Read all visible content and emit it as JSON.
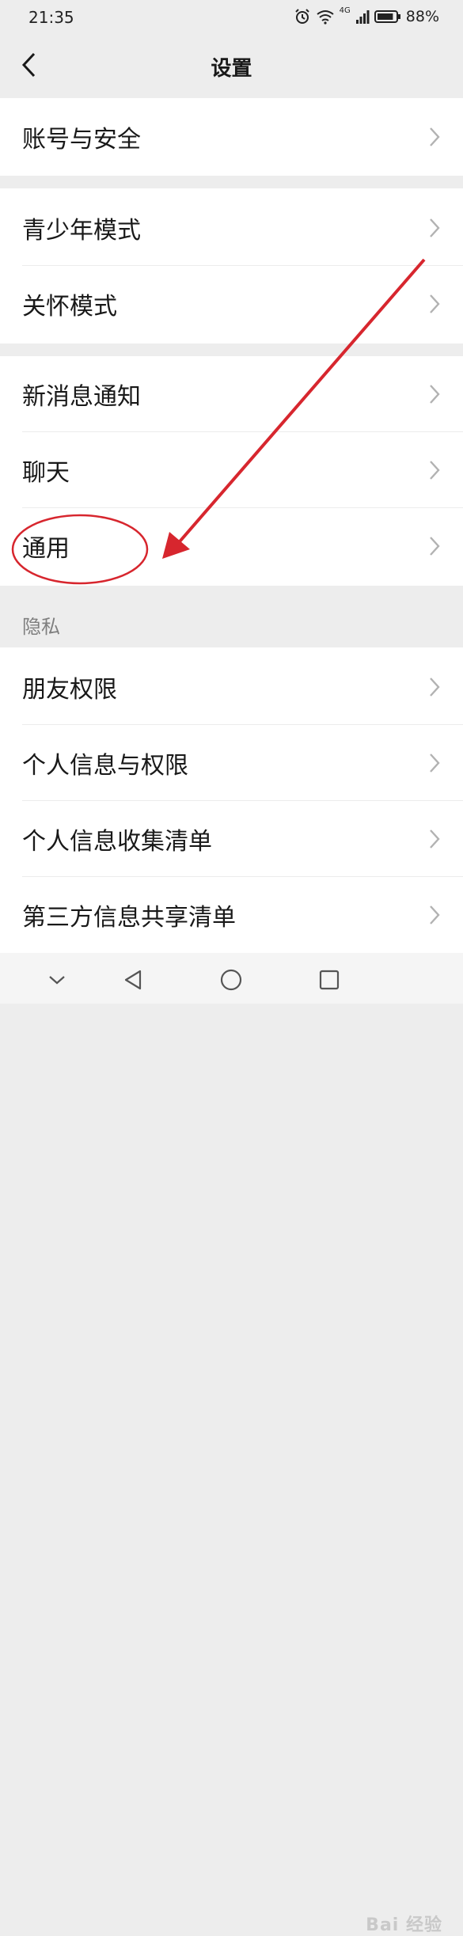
{
  "status_bar": {
    "time": "21:35",
    "network": "4G",
    "battery": "88%",
    "battery_level": 0.88,
    "icons": [
      "alarm-icon",
      "wifi-icon",
      "signal-icon",
      "battery-icon"
    ]
  },
  "nav": {
    "title": "设置",
    "back_icon": "chevron-left-icon"
  },
  "groups": [
    {
      "items": [
        {
          "label": "账号与安全"
        }
      ]
    },
    {
      "items": [
        {
          "label": "青少年模式"
        },
        {
          "label": "关怀模式"
        }
      ]
    },
    {
      "items": [
        {
          "label": "新消息通知"
        },
        {
          "label": "聊天"
        },
        {
          "label": "通用",
          "highlighted": true
        }
      ]
    },
    {
      "header": "隐私",
      "items": [
        {
          "label": "朋友权限"
        },
        {
          "label": "个人信息与权限"
        },
        {
          "label": "个人信息收集清单"
        },
        {
          "label": "第三方信息共享清单"
        }
      ]
    }
  ],
  "bottom_nav": {
    "icons": [
      "chevron-down-icon",
      "back-triangle-icon",
      "home-circle-icon",
      "recents-square-icon"
    ]
  },
  "annotation": {
    "color": "#d7262e",
    "target": "通用"
  },
  "watermark": {
    "text": "Bai 经验"
  },
  "colors": {
    "background": "#ededed",
    "card": "#ffffff",
    "text": "#191919",
    "secondary_text": "#7f7f7f",
    "arrow": "#b2b2b2"
  }
}
